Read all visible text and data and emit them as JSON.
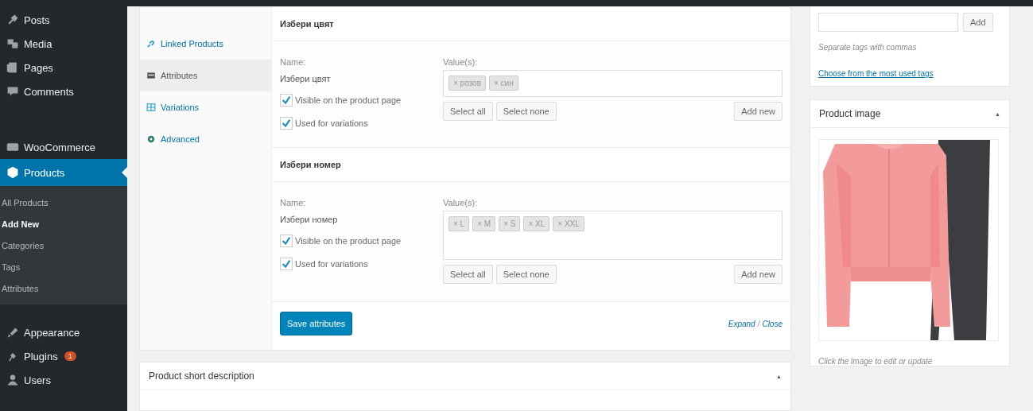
{
  "sidebar": {
    "items": [
      {
        "label": "Posts",
        "selected": false
      },
      {
        "label": "Media",
        "selected": false
      },
      {
        "label": "Pages",
        "selected": false
      },
      {
        "label": "Comments",
        "selected": false
      },
      {
        "label": "WooCommerce",
        "selected": false
      },
      {
        "label": "Products",
        "selected": true,
        "children": [
          {
            "label": "All Products",
            "selected": false
          },
          {
            "label": "Add New",
            "selected": true
          },
          {
            "label": "Categories",
            "selected": false
          },
          {
            "label": "Tags",
            "selected": false
          },
          {
            "label": "Attributes",
            "selected": false
          }
        ]
      },
      {
        "label": "Appearance",
        "selected": false
      },
      {
        "label": "Plugins",
        "selected": false,
        "badge": "1"
      },
      {
        "label": "Users",
        "selected": false
      }
    ]
  },
  "product_data": {
    "tabs": [
      {
        "label": "Linked Products",
        "selected": false
      },
      {
        "label": "Attributes",
        "selected": true
      },
      {
        "label": "Variations",
        "selected": false
      },
      {
        "label": "Advanced",
        "selected": false
      }
    ],
    "attributes": [
      {
        "title": "Избери цвят",
        "name_label": "Name:",
        "name": "Избери цвят",
        "values_label": "Value(s):",
        "values": [
          "× розов",
          "× син"
        ],
        "options": [
          {
            "label": "Visible on the product page",
            "checked": true
          },
          {
            "label": "Used for variations",
            "checked": true
          }
        ],
        "buttons": [
          "Select all",
          "Select none"
        ],
        "add_button": "Add new"
      },
      {
        "title": "Избери номер",
        "name_label": "Name:",
        "name": "Избери номер",
        "values_label": "Value(s):",
        "values": [
          "× L",
          "× M",
          "× S",
          "× XL",
          "× XXL"
        ],
        "options": [
          {
            "label": "Visible on the product page",
            "checked": true
          },
          {
            "label": "Used for variations",
            "checked": true
          }
        ],
        "buttons": [
          "Select all",
          "Select none"
        ],
        "add_button": "Add new"
      }
    ],
    "save_button": "Save attributes",
    "expand_link": "Expand",
    "link_separator": "/",
    "close_link": "Close"
  },
  "short_description": {
    "title": "Product short description",
    "toggle": "▲"
  },
  "tags": {
    "add_button": "Add",
    "hint": "Separate tags with commas",
    "link": "Choose from the most used tags"
  },
  "product_image": {
    "title": "Product image",
    "toggle": "▲",
    "caption": "Click the image to edit or update"
  }
}
